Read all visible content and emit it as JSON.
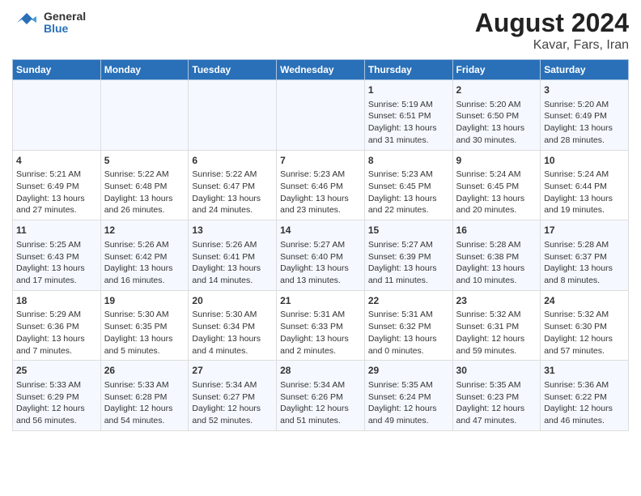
{
  "header": {
    "logo_line1": "General",
    "logo_line2": "Blue",
    "title": "August 2024",
    "subtitle": "Kavar, Fars, Iran"
  },
  "days_of_week": [
    "Sunday",
    "Monday",
    "Tuesday",
    "Wednesday",
    "Thursday",
    "Friday",
    "Saturday"
  ],
  "weeks": [
    [
      {
        "day": "",
        "content": ""
      },
      {
        "day": "",
        "content": ""
      },
      {
        "day": "",
        "content": ""
      },
      {
        "day": "",
        "content": ""
      },
      {
        "day": "1",
        "content": "Sunrise: 5:19 AM\nSunset: 6:51 PM\nDaylight: 13 hours\nand 31 minutes."
      },
      {
        "day": "2",
        "content": "Sunrise: 5:20 AM\nSunset: 6:50 PM\nDaylight: 13 hours\nand 30 minutes."
      },
      {
        "day": "3",
        "content": "Sunrise: 5:20 AM\nSunset: 6:49 PM\nDaylight: 13 hours\nand 28 minutes."
      }
    ],
    [
      {
        "day": "4",
        "content": "Sunrise: 5:21 AM\nSunset: 6:49 PM\nDaylight: 13 hours\nand 27 minutes."
      },
      {
        "day": "5",
        "content": "Sunrise: 5:22 AM\nSunset: 6:48 PM\nDaylight: 13 hours\nand 26 minutes."
      },
      {
        "day": "6",
        "content": "Sunrise: 5:22 AM\nSunset: 6:47 PM\nDaylight: 13 hours\nand 24 minutes."
      },
      {
        "day": "7",
        "content": "Sunrise: 5:23 AM\nSunset: 6:46 PM\nDaylight: 13 hours\nand 23 minutes."
      },
      {
        "day": "8",
        "content": "Sunrise: 5:23 AM\nSunset: 6:45 PM\nDaylight: 13 hours\nand 22 minutes."
      },
      {
        "day": "9",
        "content": "Sunrise: 5:24 AM\nSunset: 6:45 PM\nDaylight: 13 hours\nand 20 minutes."
      },
      {
        "day": "10",
        "content": "Sunrise: 5:24 AM\nSunset: 6:44 PM\nDaylight: 13 hours\nand 19 minutes."
      }
    ],
    [
      {
        "day": "11",
        "content": "Sunrise: 5:25 AM\nSunset: 6:43 PM\nDaylight: 13 hours\nand 17 minutes."
      },
      {
        "day": "12",
        "content": "Sunrise: 5:26 AM\nSunset: 6:42 PM\nDaylight: 13 hours\nand 16 minutes."
      },
      {
        "day": "13",
        "content": "Sunrise: 5:26 AM\nSunset: 6:41 PM\nDaylight: 13 hours\nand 14 minutes."
      },
      {
        "day": "14",
        "content": "Sunrise: 5:27 AM\nSunset: 6:40 PM\nDaylight: 13 hours\nand 13 minutes."
      },
      {
        "day": "15",
        "content": "Sunrise: 5:27 AM\nSunset: 6:39 PM\nDaylight: 13 hours\nand 11 minutes."
      },
      {
        "day": "16",
        "content": "Sunrise: 5:28 AM\nSunset: 6:38 PM\nDaylight: 13 hours\nand 10 minutes."
      },
      {
        "day": "17",
        "content": "Sunrise: 5:28 AM\nSunset: 6:37 PM\nDaylight: 13 hours\nand 8 minutes."
      }
    ],
    [
      {
        "day": "18",
        "content": "Sunrise: 5:29 AM\nSunset: 6:36 PM\nDaylight: 13 hours\nand 7 minutes."
      },
      {
        "day": "19",
        "content": "Sunrise: 5:30 AM\nSunset: 6:35 PM\nDaylight: 13 hours\nand 5 minutes."
      },
      {
        "day": "20",
        "content": "Sunrise: 5:30 AM\nSunset: 6:34 PM\nDaylight: 13 hours\nand 4 minutes."
      },
      {
        "day": "21",
        "content": "Sunrise: 5:31 AM\nSunset: 6:33 PM\nDaylight: 13 hours\nand 2 minutes."
      },
      {
        "day": "22",
        "content": "Sunrise: 5:31 AM\nSunset: 6:32 PM\nDaylight: 13 hours\nand 0 minutes."
      },
      {
        "day": "23",
        "content": "Sunrise: 5:32 AM\nSunset: 6:31 PM\nDaylight: 12 hours\nand 59 minutes."
      },
      {
        "day": "24",
        "content": "Sunrise: 5:32 AM\nSunset: 6:30 PM\nDaylight: 12 hours\nand 57 minutes."
      }
    ],
    [
      {
        "day": "25",
        "content": "Sunrise: 5:33 AM\nSunset: 6:29 PM\nDaylight: 12 hours\nand 56 minutes."
      },
      {
        "day": "26",
        "content": "Sunrise: 5:33 AM\nSunset: 6:28 PM\nDaylight: 12 hours\nand 54 minutes."
      },
      {
        "day": "27",
        "content": "Sunrise: 5:34 AM\nSunset: 6:27 PM\nDaylight: 12 hours\nand 52 minutes."
      },
      {
        "day": "28",
        "content": "Sunrise: 5:34 AM\nSunset: 6:26 PM\nDaylight: 12 hours\nand 51 minutes."
      },
      {
        "day": "29",
        "content": "Sunrise: 5:35 AM\nSunset: 6:24 PM\nDaylight: 12 hours\nand 49 minutes."
      },
      {
        "day": "30",
        "content": "Sunrise: 5:35 AM\nSunset: 6:23 PM\nDaylight: 12 hours\nand 47 minutes."
      },
      {
        "day": "31",
        "content": "Sunrise: 5:36 AM\nSunset: 6:22 PM\nDaylight: 12 hours\nand 46 minutes."
      }
    ]
  ]
}
